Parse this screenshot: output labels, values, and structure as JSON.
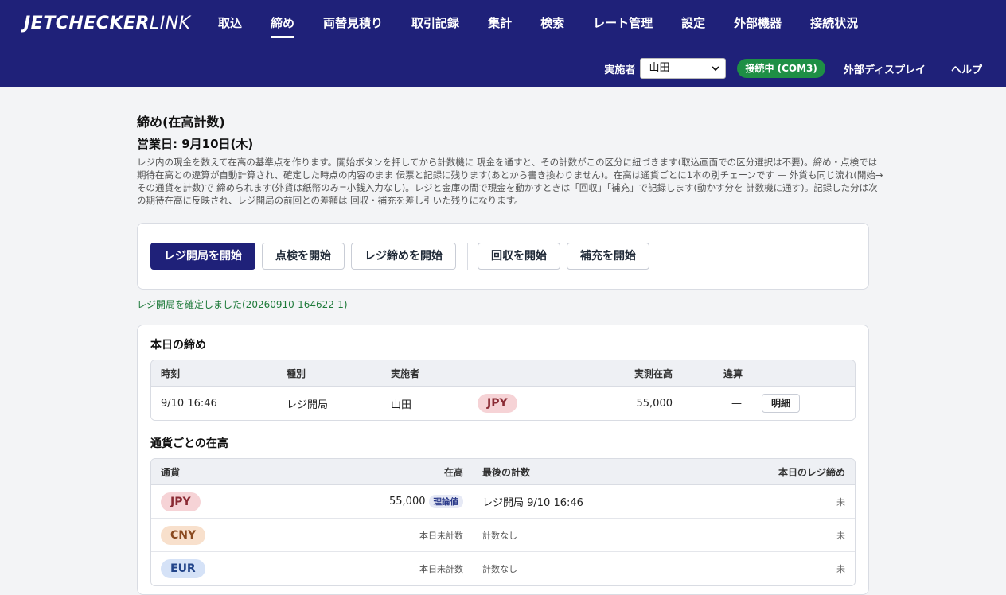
{
  "header": {
    "logo_bold": "JETCHECKER",
    "logo_light": "LINK",
    "tabs": [
      "取込",
      "締め",
      "両替見積り",
      "取引記録",
      "集計",
      "検索",
      "レート管理",
      "設定",
      "外部機器",
      "接続状況"
    ],
    "active_tab": "締め",
    "operator_label": "実施者",
    "operator_value": "山田",
    "connection_status": "接続中 (COM3)",
    "external_display": "外部ディスプレイ",
    "help": "ヘルプ"
  },
  "page": {
    "title": "締め(在高計数)",
    "business_date": "営業日: 9月10日(木)",
    "description": "レジ内の現金を数えて在高の基準点を作ります。開始ボタンを押してから計数機に 現金を通すと、その計数がこの区分に紐づきます(取込画面での区分選択は不要)。締め・点検では期待在高との違算が自動計算され、確定した時点の内容のまま 伝票と記録に残ります(あとから書き換わりません)。在高は通貨ごとに1本の別チェーンです — 外貨も同じ流れ(開始→その通貨を計数)で 締められます(外貨は紙幣のみ=小銭入力なし)。レジと金庫の間で現金を動かすときは「回収」「補充」で記録します(動かす分を 計数機に通す)。記録した分は次の期待在高に反映され、レジ開局の前回との差額は 回収・補充を差し引いた残りになります。"
  },
  "actions": {
    "open_register": "レジ開局を開始",
    "inspect": "点検を開始",
    "close_register": "レジ締めを開始",
    "collect": "回収を開始",
    "replenish": "補充を開始"
  },
  "status_message": "レジ開局を確定しました(20260910-164622-1)",
  "today_closings": {
    "title": "本日の締め",
    "headers": {
      "time": "時刻",
      "type": "種別",
      "operator": "実施者",
      "measured": "実測在高",
      "diff": "違算"
    },
    "rows": [
      {
        "time": "9/10 16:46",
        "type": "レジ開局",
        "operator": "山田",
        "currency": "JPY",
        "measured": "55,000",
        "diff": "—",
        "detail": "明細"
      }
    ]
  },
  "balances": {
    "title": "通貨ごとの在高",
    "headers": {
      "currency": "通貨",
      "balance": "在高",
      "last_count": "最後の計数",
      "today_close": "本日のレジ締め"
    },
    "rows": [
      {
        "currency": "JPY",
        "balance": "55,000",
        "tag": "理論値",
        "last_count": "レジ開局 9/10 16:46",
        "today_close": "未"
      },
      {
        "currency": "CNY",
        "balance": "本日未計数",
        "tag": "",
        "last_count": "計数なし",
        "today_close": "未"
      },
      {
        "currency": "EUR",
        "balance": "本日未計数",
        "tag": "",
        "last_count": "計数なし",
        "today_close": "未"
      }
    ]
  },
  "colors": {
    "header_bg": "#1f2179",
    "primary": "#1f2179",
    "success": "#1e8f45"
  }
}
